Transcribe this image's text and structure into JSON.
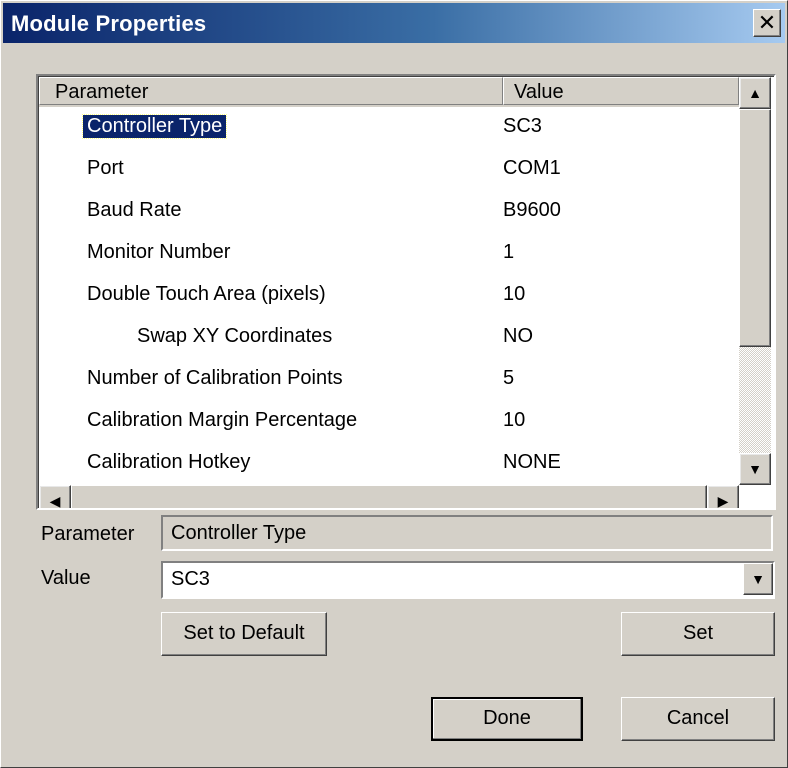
{
  "window": {
    "title": "Module Properties",
    "close_symbol": "✕"
  },
  "list": {
    "columns": [
      "Parameter",
      "Value"
    ],
    "rows": [
      {
        "parameter": "Controller Type",
        "value": "SC3"
      },
      {
        "parameter": "Port",
        "value": "COM1"
      },
      {
        "parameter": "Baud Rate",
        "value": "B9600"
      },
      {
        "parameter": "Monitor Number",
        "value": "1"
      },
      {
        "parameter": "Double Touch Area (pixels)",
        "value": "10"
      },
      {
        "parameter": "Swap XY Coordinates",
        "value": "NO"
      },
      {
        "parameter": "Number of Calibration Points",
        "value": "5"
      },
      {
        "parameter": "Calibration Margin Percentage",
        "value": "10"
      },
      {
        "parameter": "Calibration Hotkey",
        "value": "NONE"
      }
    ],
    "scroll_up": "▲",
    "scroll_down": "▼",
    "scroll_left": "◀",
    "scroll_right": "▶"
  },
  "details": {
    "parameter_label": "Parameter",
    "parameter_value": "Controller Type",
    "value_label": "Value",
    "value_selected": "SC3",
    "dropdown_arrow": "▼"
  },
  "buttons": {
    "set_default": "Set to Default",
    "set": "Set",
    "done": "Done",
    "cancel": "Cancel"
  },
  "colors": {
    "selection": "#0a246a",
    "face": "#d4d0c8"
  }
}
